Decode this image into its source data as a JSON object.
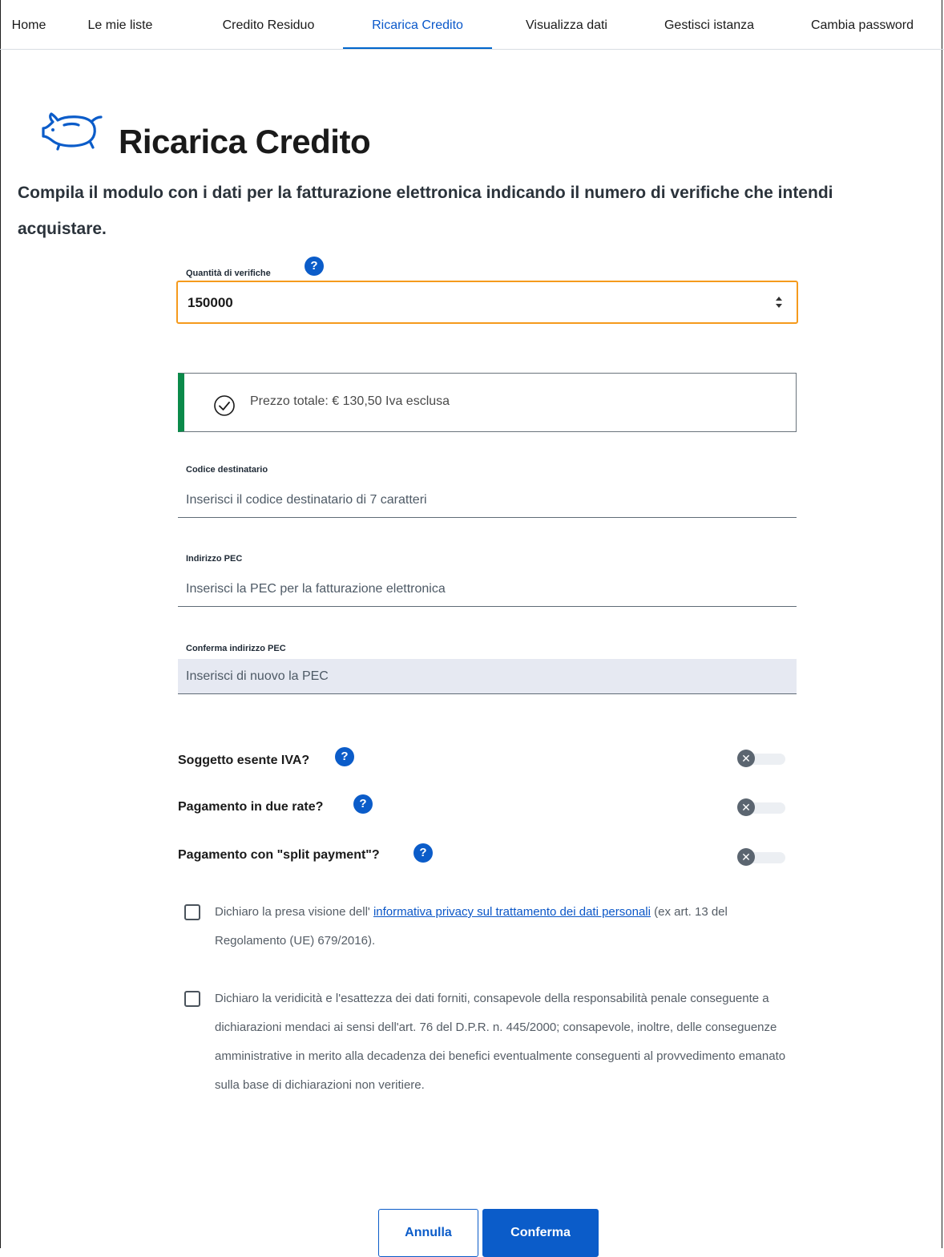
{
  "nav": {
    "items": [
      {
        "label": "Home"
      },
      {
        "label": "Le mie liste"
      },
      {
        "label": "Credito Residuo"
      },
      {
        "label": "Ricarica Credito"
      },
      {
        "label": "Visualizza dati"
      },
      {
        "label": "Gestisci istanza"
      },
      {
        "label": "Cambia password"
      }
    ],
    "active": "Ricarica Credito"
  },
  "header": {
    "icon": "piggy-bank-icon",
    "title": "Ricarica Credito",
    "subtitle": "Compila il modulo con i dati per la fatturazione elettronica indicando il numero di verifiche che intendi acquistare."
  },
  "form": {
    "quantity": {
      "label": "Quantità di verifiche",
      "value": "150000",
      "help": "?"
    },
    "price": {
      "text": "Prezzo totale: € 130,50 Iva esclusa",
      "icon": "check-circle-icon"
    },
    "codice": {
      "label": "Codice destinatario",
      "placeholder": "Inserisci il codice destinatario di 7 caratteri"
    },
    "pec": {
      "label": "Indirizzo PEC",
      "placeholder": "Inserisci la PEC per la fatturazione elettronica"
    },
    "pec_confirm": {
      "label": "Conferma indirizzo PEC",
      "placeholder": "Inserisci di nuovo la PEC"
    },
    "toggles": [
      {
        "label": "Soggetto esente IVA?",
        "checked": false
      },
      {
        "label": "Pagamento in due rate?",
        "checked": false
      },
      {
        "label": "Pagamento con \"split payment\"?",
        "checked": false
      }
    ],
    "help_symbol": "?",
    "toggle_off_symbol": "✕",
    "privacy": {
      "before": "Dichiaro la presa visione dell' ",
      "link": "informativa privacy sul trattamento dei dati personali",
      "after": " (ex art. 13 del Regolamento (UE) 679/2016).",
      "checked": false
    },
    "declaration": {
      "text": "Dichiaro la veridicità e l'esattezza dei dati forniti, consapevole della responsabilità penale conseguente a dichiarazioni mendaci ai sensi dell'art. 76 del D.P.R. n. 445/2000; consapevole, inoltre, delle conseguenze amministrative in merito alla decadenza dei benefici eventualmente conseguenti al provvedimento emanato sulla base di dichiarazioni non veritiere.",
      "checked": false
    }
  },
  "buttons": {
    "cancel": "Annulla",
    "confirm": "Conferma"
  },
  "colors": {
    "primary": "#0b5cc9",
    "focus_border": "#f59a1c",
    "success_bar": "#0b8a4a"
  }
}
